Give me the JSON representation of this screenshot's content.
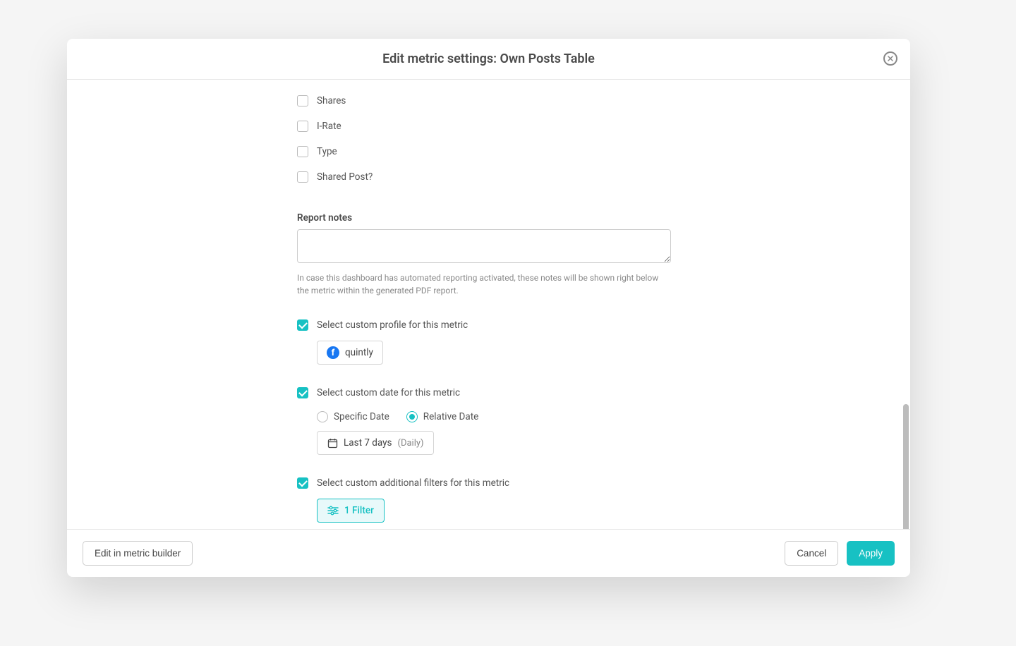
{
  "modal": {
    "title": "Edit metric settings: Own Posts Table"
  },
  "columns": {
    "items": [
      {
        "label": "Shares",
        "checked": false
      },
      {
        "label": "I-Rate",
        "checked": false
      },
      {
        "label": "Type",
        "checked": false
      },
      {
        "label": "Shared Post?",
        "checked": false
      }
    ]
  },
  "report_notes": {
    "label": "Report notes",
    "value": "",
    "helper": "In case this dashboard has automated reporting activated, these notes will be shown right below the metric within the generated PDF report."
  },
  "custom_profile": {
    "label": "Select custom profile for this metric",
    "checked": true,
    "profile_name": "quintly"
  },
  "custom_date": {
    "label": "Select custom date for this metric",
    "checked": true,
    "specific_label": "Specific Date",
    "relative_label": "Relative Date",
    "selected": "relative",
    "range_label": "Last 7 days",
    "granularity": "(Daily)"
  },
  "custom_filters": {
    "label": "Select custom additional filters for this metric",
    "checked": true,
    "button_label": "1 Filter"
  },
  "footer": {
    "edit_builder": "Edit in metric builder",
    "cancel": "Cancel",
    "apply": "Apply"
  }
}
